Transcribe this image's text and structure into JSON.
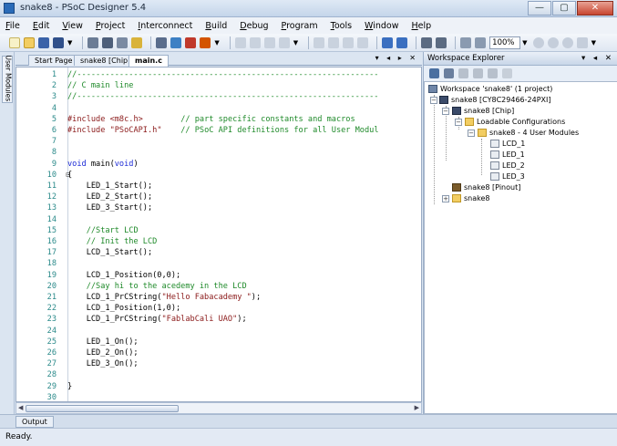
{
  "window": {
    "title": "snake8 - PSoC Designer 5.4",
    "controls": [
      "—",
      "▢",
      "✕"
    ]
  },
  "menu": [
    "File",
    "Edit",
    "View",
    "Project",
    "Interconnect",
    "Build",
    "Debug",
    "Program",
    "Tools",
    "Window",
    "Help"
  ],
  "toolbar": {
    "zoom": "100%"
  },
  "side_tab": "User Modules",
  "editor": {
    "tabs": [
      "Start Page",
      "snake8 [Chip]",
      "main.c"
    ],
    "active_tab": "main.c",
    "tab_controls": "▾ ◂ ▸ ✕",
    "lines": [
      {
        "n": "1",
        "fold": "",
        "parts": [
          [
            "cm",
            "//----------------------------------------------------------------"
          ]
        ]
      },
      {
        "n": "2",
        "fold": "",
        "parts": [
          [
            "cm",
            "// C main line"
          ]
        ]
      },
      {
        "n": "3",
        "fold": "",
        "parts": [
          [
            "cm",
            "//----------------------------------------------------------------"
          ]
        ]
      },
      {
        "n": "4",
        "fold": "",
        "parts": []
      },
      {
        "n": "5",
        "fold": "",
        "parts": [
          [
            "pp",
            "#include "
          ],
          [
            "str",
            "<m8c.h>"
          ],
          [
            "",
            "        "
          ],
          [
            "cm",
            "// part specific constants and macros"
          ]
        ]
      },
      {
        "n": "6",
        "fold": "",
        "parts": [
          [
            "pp",
            "#include "
          ],
          [
            "str",
            "\"PSoCAPI.h\""
          ],
          [
            "",
            "    "
          ],
          [
            "cm",
            "// PSoC API definitions for all User Modul"
          ]
        ]
      },
      {
        "n": "7",
        "fold": "",
        "parts": []
      },
      {
        "n": "8",
        "fold": "",
        "parts": []
      },
      {
        "n": "9",
        "fold": "",
        "parts": [
          [
            "kw",
            "void"
          ],
          [
            "",
            " main("
          ],
          [
            "kw",
            "void"
          ],
          [
            "",
            ")"
          ]
        ]
      },
      {
        "n": "10",
        "fold": "⊟",
        "parts": [
          [
            "",
            "{"
          ]
        ]
      },
      {
        "n": "11",
        "fold": "",
        "parts": [
          [
            "",
            "    LED_1_Start();"
          ]
        ]
      },
      {
        "n": "12",
        "fold": "",
        "parts": [
          [
            "",
            "    LED_2_Start();"
          ]
        ]
      },
      {
        "n": "13",
        "fold": "",
        "parts": [
          [
            "",
            "    LED_3_Start();"
          ]
        ]
      },
      {
        "n": "14",
        "fold": "",
        "parts": []
      },
      {
        "n": "15",
        "fold": "",
        "parts": [
          [
            "",
            "    "
          ],
          [
            "cm",
            "//Start LCD"
          ]
        ]
      },
      {
        "n": "16",
        "fold": "",
        "parts": [
          [
            "",
            "    "
          ],
          [
            "cm",
            "// Init the LCD"
          ]
        ]
      },
      {
        "n": "17",
        "fold": "",
        "parts": [
          [
            "",
            "    LCD_1_Start();"
          ]
        ]
      },
      {
        "n": "18",
        "fold": "",
        "parts": []
      },
      {
        "n": "19",
        "fold": "",
        "parts": [
          [
            "",
            "    LCD_1_Position(0,0);"
          ]
        ]
      },
      {
        "n": "20",
        "fold": "",
        "parts": [
          [
            "",
            "    "
          ],
          [
            "cm",
            "//Say hi to the acedemy in the LCD"
          ]
        ]
      },
      {
        "n": "21",
        "fold": "",
        "parts": [
          [
            "",
            "    LCD_1_PrCString("
          ],
          [
            "str",
            "\"Hello Fabacademy \""
          ],
          [
            "",
            ");"
          ]
        ]
      },
      {
        "n": "22",
        "fold": "",
        "parts": [
          [
            "",
            "    LCD_1_Position(1,0);"
          ]
        ]
      },
      {
        "n": "23",
        "fold": "",
        "parts": [
          [
            "",
            "    LCD_1_PrCString("
          ],
          [
            "str",
            "\"FablabCali UAO\""
          ],
          [
            "",
            ");"
          ]
        ]
      },
      {
        "n": "24",
        "fold": "",
        "parts": []
      },
      {
        "n": "25",
        "fold": "",
        "parts": [
          [
            "",
            "    LED_1_On();"
          ]
        ]
      },
      {
        "n": "26",
        "fold": "",
        "parts": [
          [
            "",
            "    LED_2_On();"
          ]
        ]
      },
      {
        "n": "27",
        "fold": "",
        "parts": [
          [
            "",
            "    LED_3_On();"
          ]
        ]
      },
      {
        "n": "28",
        "fold": "",
        "parts": []
      },
      {
        "n": "29",
        "fold": "",
        "parts": [
          [
            "",
            "}"
          ]
        ]
      },
      {
        "n": "30",
        "fold": "",
        "parts": []
      }
    ]
  },
  "explorer": {
    "title": "Workspace Explorer",
    "title_controls": "▾ ◂ ✕",
    "tree": {
      "workspace": "Workspace 'snake8' (1 project)",
      "project": "snake8 [CY8C29466-24PXI]",
      "chip": "snake8 [Chip]",
      "loadable": "Loadable Configurations",
      "config": "snake8 - 4 User Modules",
      "modules": [
        "LCD_1",
        "LED_1",
        "LED_2",
        "LED_3"
      ],
      "pinout": "snake8 [Pinout]",
      "folder": "snake8"
    }
  },
  "output_tab": "Output",
  "status": "Ready."
}
